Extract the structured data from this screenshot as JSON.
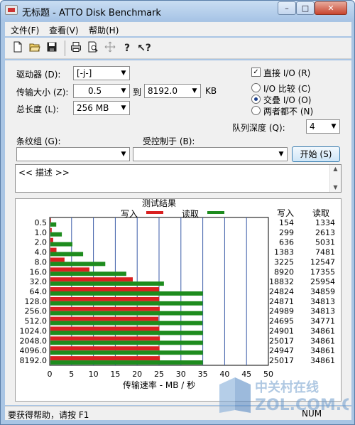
{
  "window": {
    "title": "无标题 - ATTO Disk Benchmark",
    "min_glyph": "–",
    "max_glyph": "□",
    "close_glyph": "✕"
  },
  "menu": {
    "items": [
      "文件(F)",
      "查看(V)",
      "帮助(H)"
    ]
  },
  "toolbar": {
    "icons": [
      "new-file-icon",
      "open-folder-icon",
      "save-icon",
      "print-icon",
      "print-preview-icon",
      "move-icon",
      "help-icon",
      "context-help-icon"
    ]
  },
  "settings": {
    "drive_label": "驱动器 (D):",
    "drive_value": "[-j-]",
    "transfer_label": "传输大小 (Z):",
    "transfer_from": "0.5",
    "to_label": "到",
    "transfer_to": "8192.0",
    "kb_unit": "KB",
    "length_label": "总长度 (L):",
    "length_value": "256 MB",
    "direct_io_label": "直接 I/O (R)",
    "direct_io_checked": true,
    "radio_compare": "I/O 比较 (C)",
    "radio_overlap": "交叠 I/O (O)",
    "radio_neither": "两者都不 (N)",
    "selected_radio": "overlap",
    "queue_label": "队列深度 (Q):",
    "queue_value": "4",
    "stripe_label": "条纹组 (G):",
    "controlled_label": "受控制于 (B):",
    "start_label": "开始 (S)",
    "description": "<< 描述 >>"
  },
  "chart_data": {
    "type": "bar",
    "orientation": "horizontal",
    "title": "测试结果",
    "xlabel": "传输速率 - MB / 秒",
    "xlim": [
      0,
      50
    ],
    "xticks": [
      0,
      5,
      10,
      15,
      20,
      25,
      30,
      35,
      40,
      45,
      50
    ],
    "categories": [
      "0.5",
      "1.0",
      "2.0",
      "4.0",
      "8.0",
      "16.0",
      "32.0",
      "64.0",
      "128.0",
      "256.0",
      "512.0",
      "1024.0",
      "2048.0",
      "4096.0",
      "8192.0"
    ],
    "series": [
      {
        "name": "写入",
        "color": "#d92020",
        "values": [
          154,
          299,
          636,
          1383,
          3225,
          8920,
          18832,
          24824,
          24871,
          24989,
          24695,
          24901,
          25017,
          24947,
          25017
        ]
      },
      {
        "name": "读取",
        "color": "#1e8c1e",
        "values": [
          1334,
          2613,
          5031,
          7481,
          12547,
          17355,
          25954,
          34859,
          34813,
          34813,
          34771,
          34861,
          34861,
          34861,
          34861
        ]
      }
    ],
    "value_unit_divisor": 1000,
    "column_headers": [
      "写入",
      "读取"
    ]
  },
  "status": {
    "help_text": "要获得帮助，请按 F1",
    "num": "NUM"
  },
  "watermark": {
    "cn": "中关村在线",
    "en": "ZOL.COM.CN"
  }
}
